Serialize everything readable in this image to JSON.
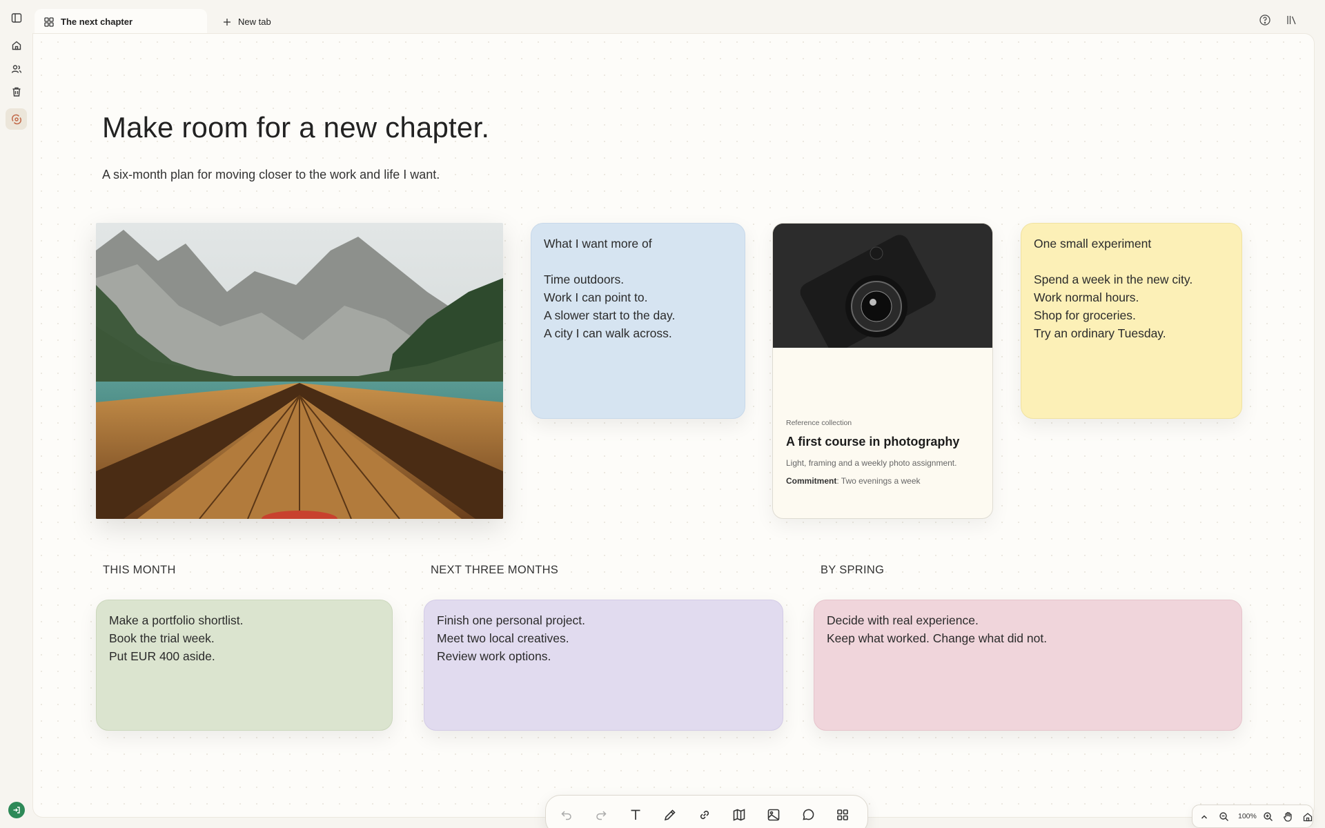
{
  "tabs": {
    "active_label": "The next chapter",
    "new_tab_label": "New tab"
  },
  "icons": {
    "sidebar_toggle": "sidebar-toggle-icon",
    "home": "home-icon",
    "members": "users-icon",
    "trash": "trash-icon",
    "active_space": "orbit-icon",
    "exit": "log-in-icon",
    "help": "help-circle-icon",
    "library": "library-icon"
  },
  "page": {
    "title": "Make room for a new chapter.",
    "subtitle": "A six-month plan for moving closer to the work and life I want."
  },
  "notes": {
    "blue": {
      "heading": "What I want more of",
      "lines": [
        "Time outdoors.",
        "Work I can point to.",
        "A slower start to the day.",
        "A city I can walk across."
      ]
    },
    "yellow": {
      "heading": "One small experiment",
      "lines": [
        "Spend a week in the new city.",
        "Work normal hours.",
        "Shop for groceries.",
        "Try an ordinary Tuesday."
      ]
    },
    "green": {
      "lines": [
        "Make a portfolio shortlist.",
        "Book the trial week.",
        "Put EUR 400 aside."
      ]
    },
    "purple": {
      "lines": [
        "Finish one personal project.",
        "Meet two local creatives.",
        "Review work options."
      ]
    },
    "pink": {
      "lines": [
        "Decide with real experience.",
        "Keep what worked. Change what did not."
      ]
    }
  },
  "card": {
    "kicker": "Reference collection",
    "title": "A first course in photography",
    "description": "Light, framing and a weekly photo assignment.",
    "meta_label": "Commitment",
    "meta_value": ": Two evenings a week"
  },
  "sections": {
    "this_month": "THIS MONTH",
    "next_three_months": "NEXT THREE MONTHS",
    "by_spring": "BY SPRING"
  },
  "toolbar": {
    "tools": [
      "undo-icon",
      "redo-icon",
      "text-icon",
      "pen-icon",
      "link-icon",
      "map-icon",
      "image-icon",
      "comment-icon",
      "apps-icon"
    ]
  },
  "zoom": {
    "level": "100%"
  },
  "colors": {
    "accent": "#c26a4a",
    "note_blue": "#d6e4f1",
    "note_yellow": "#fcf0b7",
    "note_green": "#dbe4cf",
    "note_purple": "#e1dbef",
    "note_pink": "#f0d5db",
    "exit_green": "#2e8a58"
  }
}
